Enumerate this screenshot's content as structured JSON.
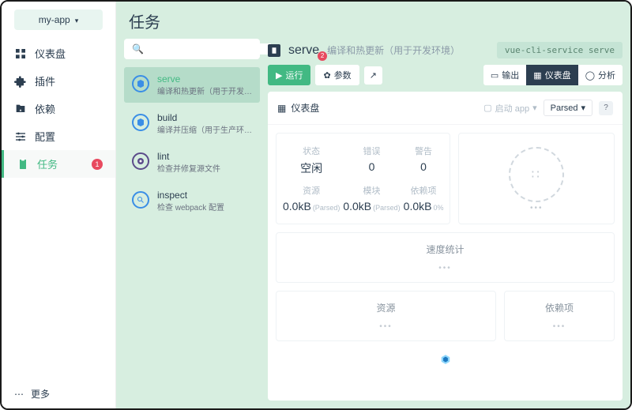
{
  "project": {
    "name": "my-app"
  },
  "sidebar": {
    "items": [
      {
        "label": "仪表盘"
      },
      {
        "label": "插件"
      },
      {
        "label": "依赖"
      },
      {
        "label": "配置"
      },
      {
        "label": "任务",
        "badge": "1"
      }
    ],
    "more": "更多"
  },
  "page": {
    "title": "任务"
  },
  "search": {
    "placeholder": ""
  },
  "tasks": [
    {
      "name": "serve",
      "desc": "编译和热更新（用于开发环…"
    },
    {
      "name": "build",
      "desc": "编译并压缩（用于生产环境…"
    },
    {
      "name": "lint",
      "desc": "检查并修复源文件"
    },
    {
      "name": "inspect",
      "desc": "检查 webpack 配置"
    }
  ],
  "detail": {
    "title": "serve",
    "badge": "2",
    "subtitle": "编译和热更新（用于开发环境）",
    "command": "vue-cli-service serve",
    "run": "运行",
    "params": "参数",
    "output": "输出",
    "dashboard": "仪表盘",
    "analyze": "分析"
  },
  "panel": {
    "title": "仪表盘",
    "launch": "启动 app",
    "parsed": "Parsed",
    "help": "?"
  },
  "stats": {
    "r1": [
      {
        "label": "状态",
        "value": "空闲"
      },
      {
        "label": "错误",
        "value": "0"
      },
      {
        "label": "警告",
        "value": "0"
      }
    ],
    "r2": [
      {
        "label": "资源",
        "value": "0.0kB",
        "sub": "(Parsed)"
      },
      {
        "label": "模块",
        "value": "0.0kB",
        "sub": "(Parsed)"
      },
      {
        "label": "依赖项",
        "value": "0.0kB",
        "sub": "0%"
      }
    ],
    "donut": "⠿",
    "ellipsis": "•••"
  },
  "cards": {
    "speed": "速度统计",
    "assets": "资源",
    "deps": "依赖项"
  }
}
